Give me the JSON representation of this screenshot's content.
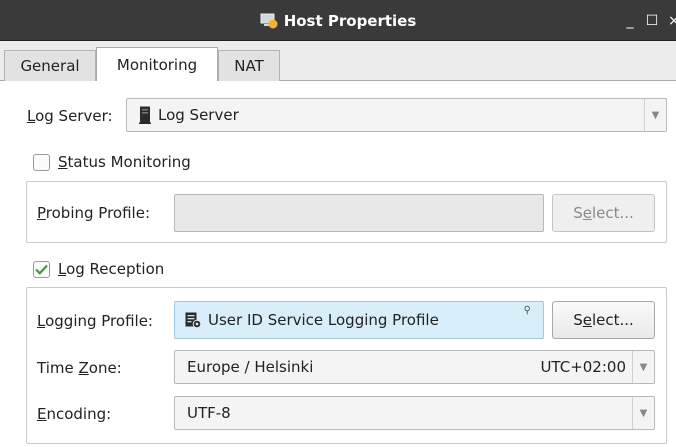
{
  "window": {
    "title": "Host Properties",
    "minimize": "_",
    "maximize": "☐",
    "close": "×"
  },
  "tabs": [
    {
      "label": "General",
      "active": false
    },
    {
      "label": "Monitoring",
      "active": true
    },
    {
      "label": "NAT",
      "active": false
    }
  ],
  "log_server": {
    "label_prefix": "L",
    "label_rest": "og Server:",
    "value": "Log Server",
    "icon": "server-icon"
  },
  "status_monitoring": {
    "checked": false,
    "label_prefix": "S",
    "label_rest": "tatus Monitoring",
    "probing_profile": {
      "label_prefix": "P",
      "label_rest": "robing Profile:",
      "value": ""
    },
    "select_button": {
      "pre": "S",
      "under": "e",
      "post": "lect..."
    }
  },
  "log_reception": {
    "checked": true,
    "label_prefix": "L",
    "label_rest": "og Reception",
    "logging_profile": {
      "label_prefix": "L",
      "label_rest": "ogging Profile:",
      "value": "User ID Service Logging Profile",
      "icon": "logging-profile-icon",
      "search_glyph": "⚲"
    },
    "select_button": {
      "pre": "S",
      "under": "e",
      "post": "lect..."
    },
    "time_zone": {
      "label_pre": "Time ",
      "label_under": "Z",
      "label_post": "one:",
      "value": "Europe / Helsinki",
      "offset": "UTC+02:00"
    },
    "encoding": {
      "label_prefix": "E",
      "label_rest": "ncoding:",
      "value": "UTF-8"
    }
  },
  "colors": {
    "titlebar": "#3a3a3a",
    "selected_field": "#d9eefb",
    "checkmark": "#3a9a3a"
  }
}
